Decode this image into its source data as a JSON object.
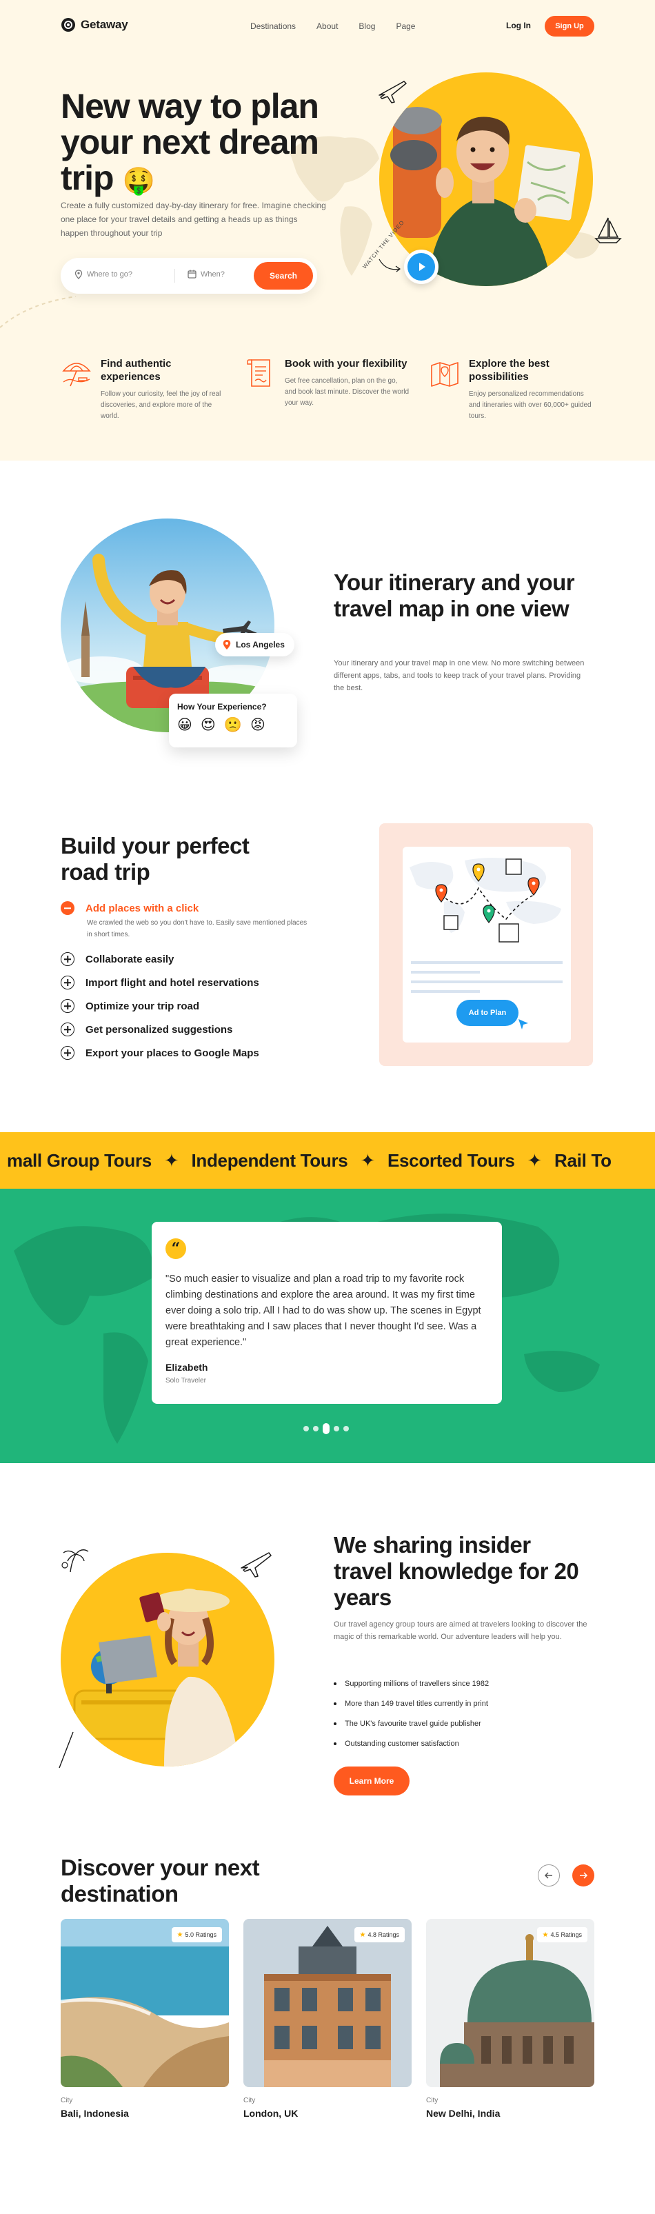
{
  "nav": {
    "brand": "Getaway",
    "links": [
      "Destinations",
      "About",
      "Blog",
      "Page"
    ],
    "login": "Log In",
    "signup": "Sign Up"
  },
  "hero": {
    "title": "New way to plan your next dream trip",
    "title_emoji": "🤑",
    "description": "Create a fully customized day-by-day itinerary for free. Imagine checking one place for your travel details and getting a heads up as things happen throughout your trip",
    "search": {
      "where_placeholder": "Where to go?",
      "when_placeholder": "When?",
      "button": "Search"
    },
    "watch_note": "WATCH THE VIDEO"
  },
  "features": [
    {
      "icon": "beach-umbrella-icon",
      "title": "Find authentic experiences",
      "text": "Follow your curiosity, feel the joy of real discoveries, and explore more of the world."
    },
    {
      "icon": "ticket-icon",
      "title": "Book with your flexibility",
      "text": "Get free cancellation, plan on the go, and book last minute. Discover the world your way."
    },
    {
      "icon": "map-icon",
      "title": "Explore the best possibilities",
      "text": "Enjoy personalized recommendations and itineraries with over 60,000+ guided tours."
    }
  ],
  "itinerary": {
    "location": "Los Angeles",
    "experience_title": "How Your Experience?",
    "emojis": [
      "😀",
      "😍",
      "🙁",
      "😡"
    ],
    "title": "Your itinerary and your travel map in one view",
    "description": "Your itinerary and your travel map in one view. No more switching between different apps, tabs, and tools to keep track of your travel plans. Providing the best."
  },
  "road_trip": {
    "title": "Build your perfect road trip",
    "active_item": "Add places with a click",
    "active_desc": "We crawled the web so you don't have to. Easily save mentioned places in short times.",
    "items": [
      "Collaborate easily",
      "Import flight and hotel reservations",
      "Optimize your trip road",
      "Get personalized suggestions",
      "Export your places to Google Maps"
    ],
    "plan_button": "Ad to Plan"
  },
  "ticker": [
    "mall Group Tours",
    "Independent Tours",
    "Escorted Tours",
    "Rail To"
  ],
  "testimonial": {
    "quote": "\"So much easier to visualize and plan a road trip to my favorite rock climbing destinations and explore the area around. It was my first time ever doing a solo trip. All I had to do was show up. The scenes in Egypt were breathtaking and I saw places that I never thought I'd see. Was a great experience.\"",
    "name": "Elizabeth",
    "role": "Solo Traveler"
  },
  "insider": {
    "title": "We sharing insider travel knowledge for 20 years",
    "description": "Our travel agency group tours are aimed at travelers looking to discover the magic of this remarkable world. Our adventure leaders will help you.",
    "points": [
      "Supporting millions of travellers since 1982",
      "More than 149 travel titles currently in print",
      "The UK's favourite travel guide publisher",
      "Outstanding customer satisfaction"
    ],
    "button": "Learn More"
  },
  "destinations": {
    "title": "Discover your next destination",
    "cards": [
      {
        "rating": "5.0 Ratings",
        "label": "City",
        "name": "Bali, Indonesia"
      },
      {
        "rating": "4.8 Ratings",
        "label": "City",
        "name": "London, UK"
      },
      {
        "rating": "4.5 Ratings",
        "label": "City",
        "name": "New Delhi, India"
      }
    ]
  },
  "colors": {
    "accent": "#ff5a1f",
    "yellow": "#ffc21a",
    "green": "#20b57a",
    "blue": "#1e9bf0",
    "cream": "#fff8e7"
  }
}
